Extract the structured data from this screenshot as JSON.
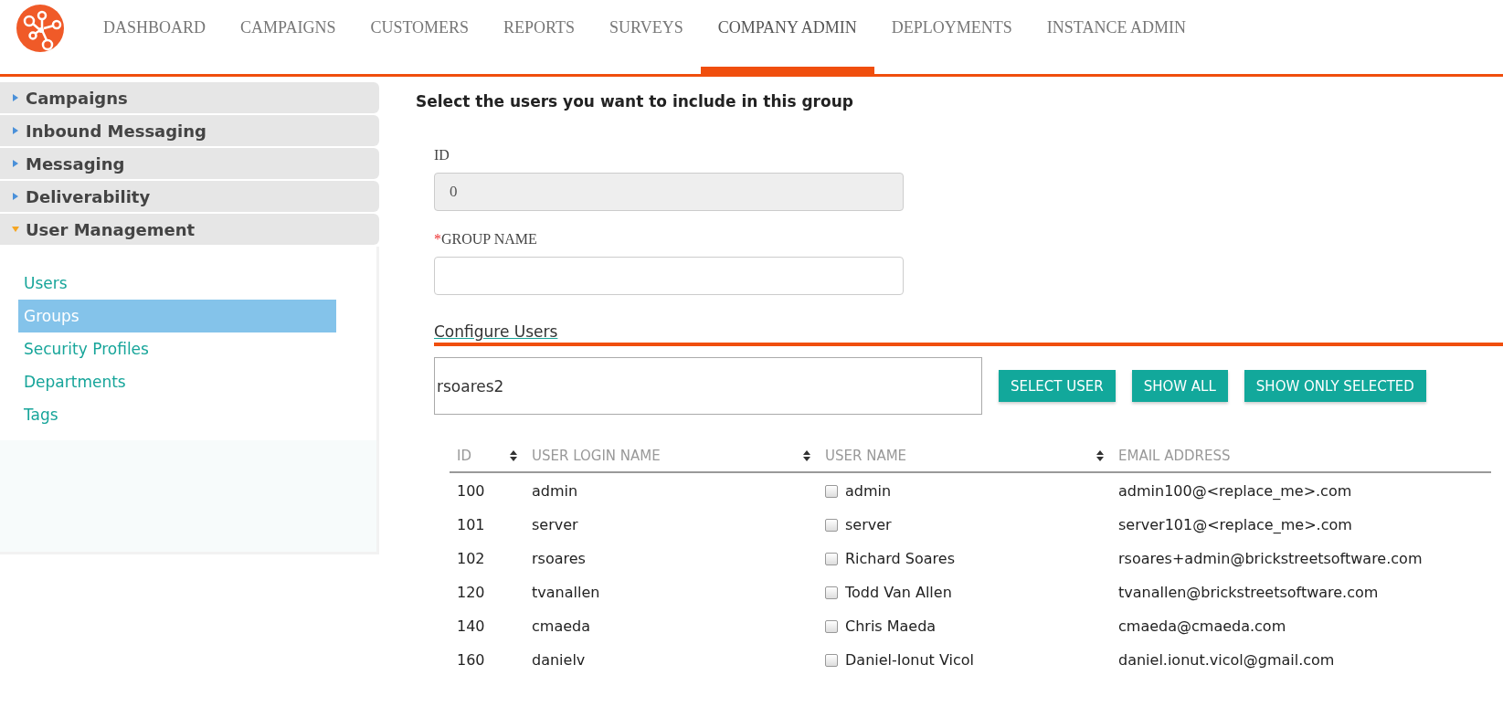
{
  "nav": [
    {
      "label": "DASHBOARD",
      "selected": false
    },
    {
      "label": "CAMPAIGNS",
      "selected": false
    },
    {
      "label": "CUSTOMERS",
      "selected": false
    },
    {
      "label": "REPORTS",
      "selected": false
    },
    {
      "label": "SURVEYS",
      "selected": false
    },
    {
      "label": "COMPANY ADMIN",
      "selected": true
    },
    {
      "label": "DEPLOYMENTS",
      "selected": false
    },
    {
      "label": "INSTANCE ADMIN",
      "selected": false
    }
  ],
  "sidebar": {
    "sections": [
      {
        "label": "Campaigns",
        "expanded": false
      },
      {
        "label": "Inbound Messaging",
        "expanded": false
      },
      {
        "label": "Messaging",
        "expanded": false
      },
      {
        "label": "Deliverability",
        "expanded": false
      },
      {
        "label": "User Management",
        "expanded": true,
        "items": [
          {
            "label": "Users",
            "selected": false
          },
          {
            "label": "Groups",
            "selected": true
          },
          {
            "label": "Security Profiles",
            "selected": false
          },
          {
            "label": "Departments",
            "selected": false
          },
          {
            "label": "Tags",
            "selected": false
          }
        ]
      }
    ]
  },
  "main": {
    "heading": "Select the users you want to include in this group",
    "id_field": {
      "label": "ID",
      "value": "0"
    },
    "group_name_field": {
      "required_mark": "*",
      "label": "GROUP NAME"
    },
    "configure_title": "Configure Users",
    "search": {
      "value": "rsoares2"
    },
    "buttons": [
      "SELECT USER",
      "SHOW ALL",
      "SHOW ONLY SELECTED"
    ],
    "table": {
      "columns": [
        "ID",
        "USER LOGIN NAME",
        "USER NAME",
        "EMAIL ADDRESS"
      ],
      "rows": [
        {
          "id": "100",
          "login": "admin",
          "name": "admin",
          "checked": false,
          "email": "admin100@<replace_me>.com"
        },
        {
          "id": "101",
          "login": "server",
          "name": "server",
          "checked": false,
          "email": "server101@<replace_me>.com"
        },
        {
          "id": "102",
          "login": "rsoares",
          "name": "Richard Soares",
          "checked": false,
          "email": "rsoares+admin@brickstreetsoftware.com"
        },
        {
          "id": "120",
          "login": "tvanallen",
          "name": "Todd Van Allen",
          "checked": false,
          "email": "tvanallen@brickstreetsoftware.com"
        },
        {
          "id": "140",
          "login": "cmaeda",
          "name": "Chris Maeda",
          "checked": false,
          "email": "cmaeda@cmaeda.com"
        },
        {
          "id": "160",
          "login": "danielv",
          "name": "Daniel-Ionut Vicol",
          "checked": false,
          "email": "daniel.ionut.vicol@gmail.com"
        }
      ]
    }
  }
}
